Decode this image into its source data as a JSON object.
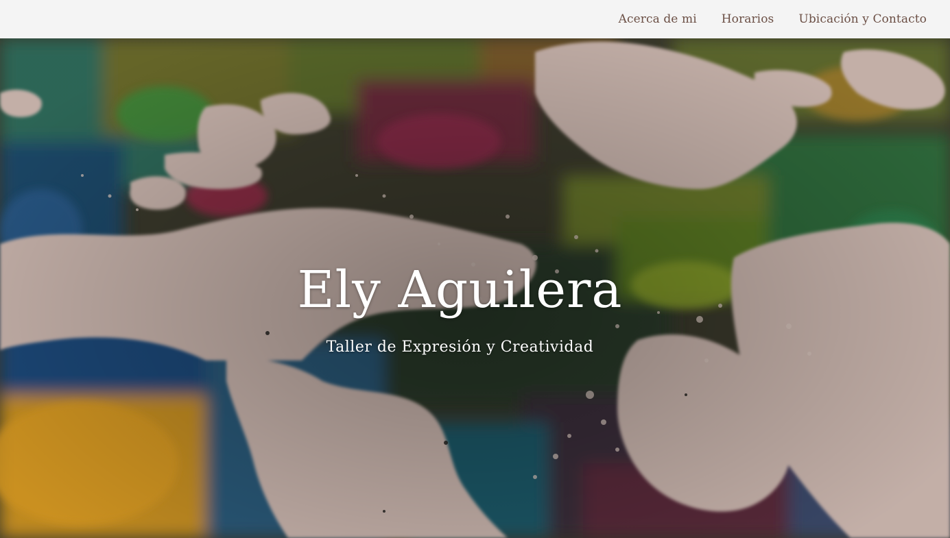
{
  "nav": {
    "items": [
      {
        "label": "Acerca de mi"
      },
      {
        "label": "Horarios"
      },
      {
        "label": "Ubicación y Contacto"
      }
    ]
  },
  "hero": {
    "title": "Ely Aguilera",
    "subtitle": "Taller de Expresión y Creatividad",
    "background": "abstract-paint-splatter-image"
  },
  "colors": {
    "navbar_bg": "#f4f4f4",
    "nav_text": "#6b4f45",
    "hero_text": "#ffffff"
  }
}
